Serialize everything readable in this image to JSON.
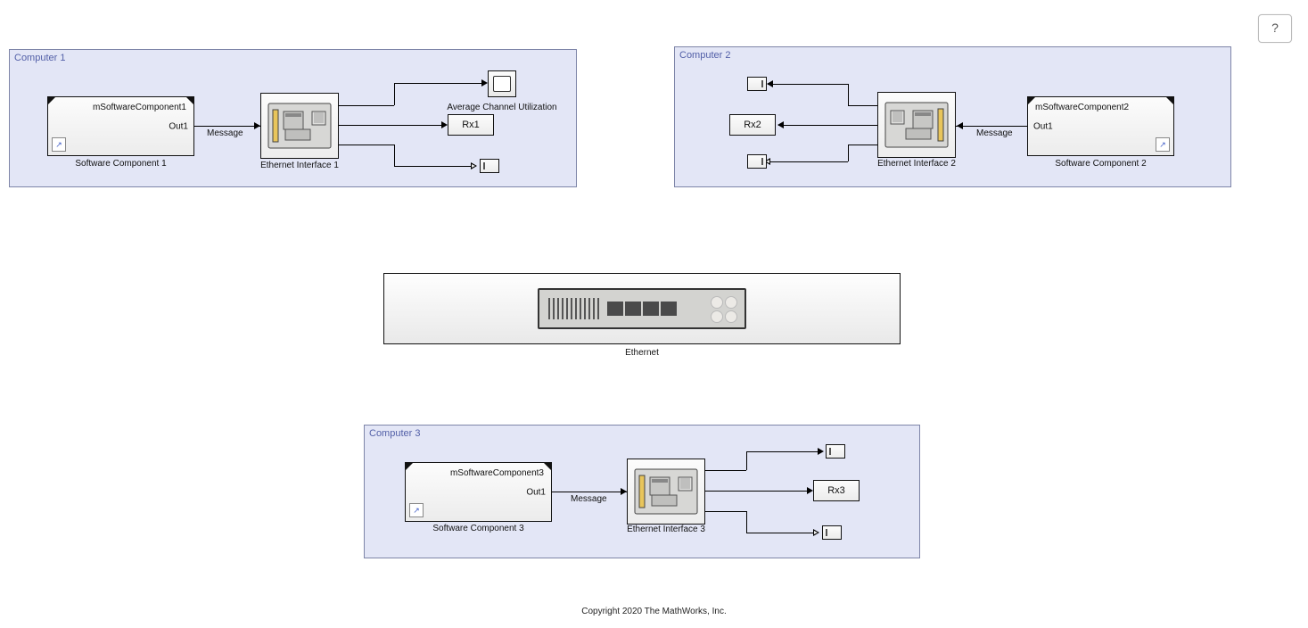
{
  "help_button": "?",
  "copyright": "Copyright 2020 The MathWorks, Inc.",
  "ethernet": {
    "label": "Ethernet"
  },
  "computers": [
    {
      "title": "Computer 1",
      "software": {
        "ref_name": "mSoftwareComponent1",
        "port_label": "Out1",
        "caption": "Software Component 1"
      },
      "signal_label": "Message",
      "interface_caption": "Ethernet Interface 1",
      "scope_caption": "Average Channel Utilization",
      "goto_label": "Rx1"
    },
    {
      "title": "Computer 2",
      "software": {
        "ref_name": "mSoftwareComponent2",
        "port_label": "Out1",
        "caption": "Software Component 2"
      },
      "signal_label": "Message",
      "interface_caption": "Ethernet Interface 2",
      "goto_label": "Rx2"
    },
    {
      "title": "Computer 3",
      "software": {
        "ref_name": "mSoftwareComponent3",
        "port_label": "Out1",
        "caption": "Software Component 3"
      },
      "signal_label": "Message",
      "interface_caption": "Ethernet Interface 3",
      "goto_label": "Rx3"
    }
  ]
}
